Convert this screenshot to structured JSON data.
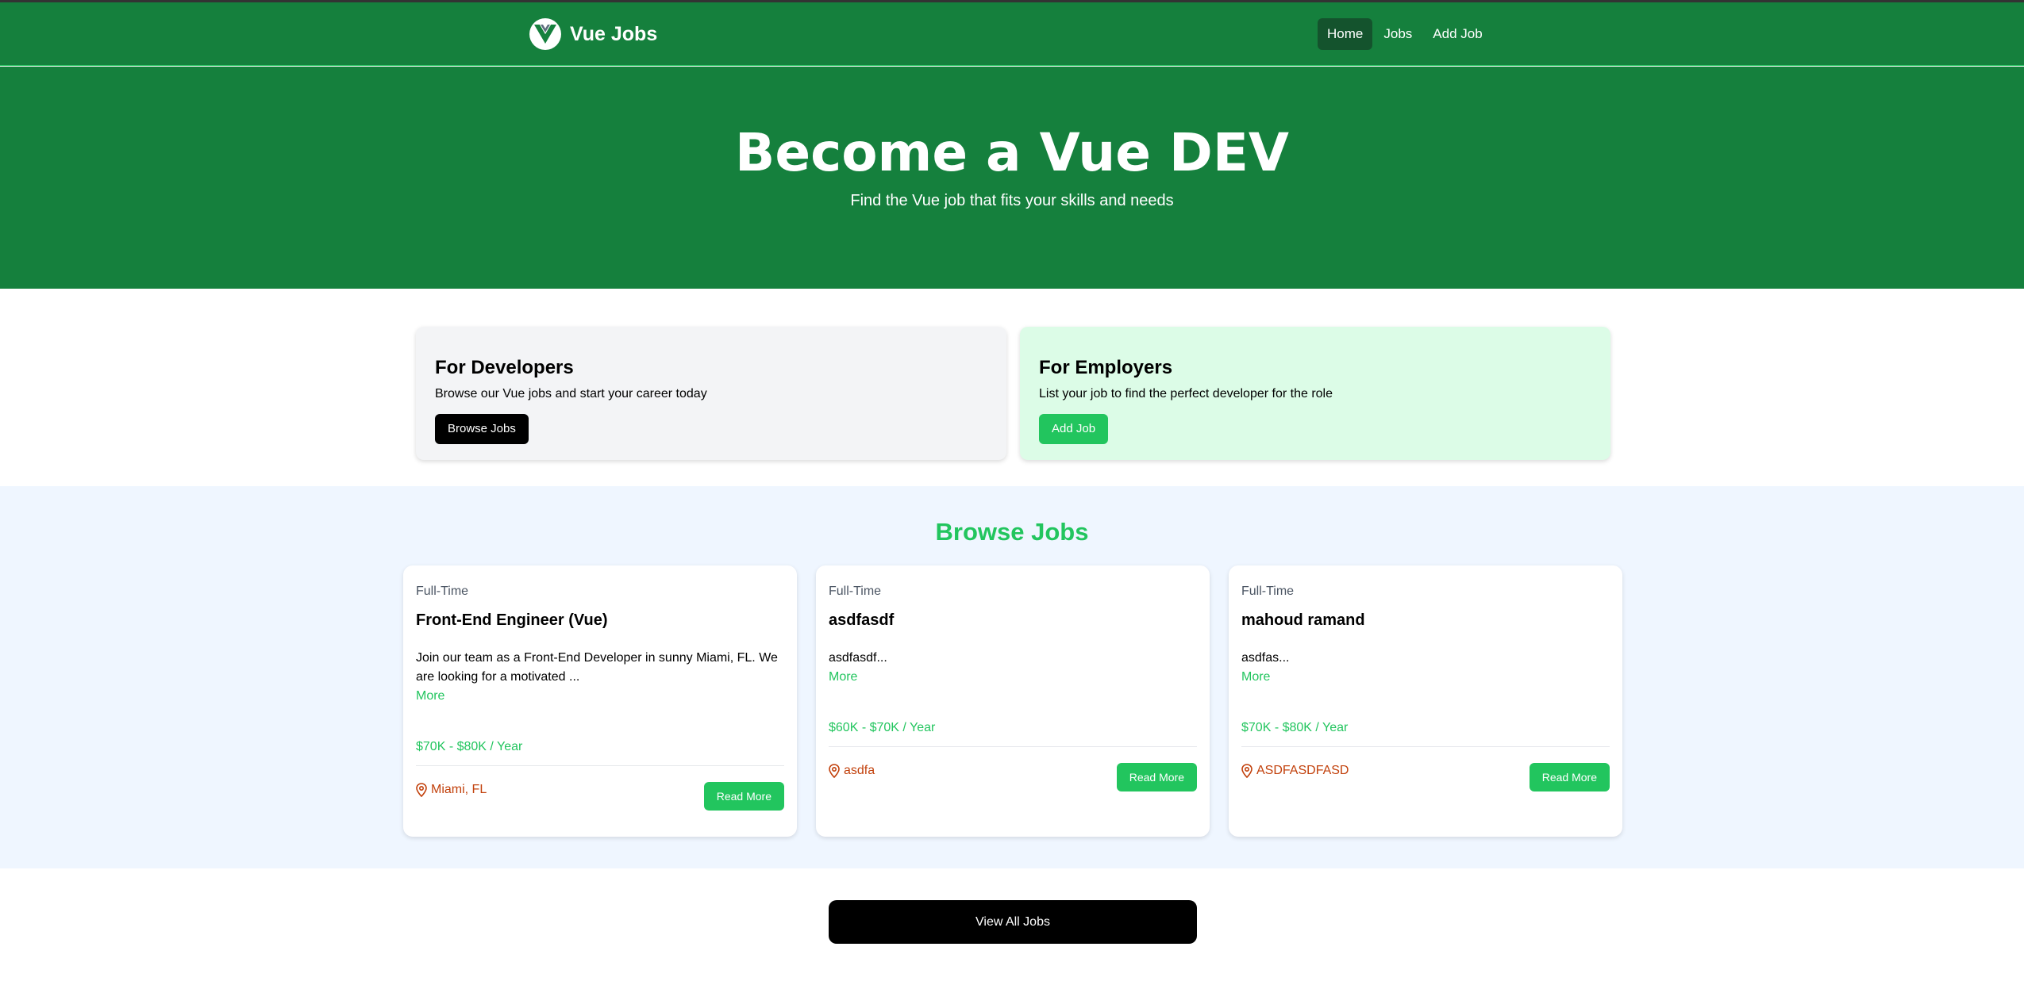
{
  "nav": {
    "brand": "Vue Jobs",
    "links": [
      {
        "label": "Home"
      },
      {
        "label": "Jobs"
      },
      {
        "label": "Add Job"
      }
    ]
  },
  "hero": {
    "title": "Become a Vue DEV",
    "subtitle": "Find the Vue job that fits your skills and needs"
  },
  "developers": {
    "title": "For Developers",
    "text": "Browse our Vue jobs and start your career today",
    "button": "Browse Jobs"
  },
  "employers": {
    "title": "For Employers",
    "text": "List your job to find the perfect developer for the role",
    "button": "Add Job"
  },
  "browse": {
    "title": "Browse Jobs",
    "jobs": [
      {
        "type": "Full-Time",
        "title": "Front-End Engineer (Vue)",
        "description": "Join our team as a Front-End Developer in sunny Miami, FL. We are looking for a motivated ...",
        "more": "More",
        "salary": "$70K - $80K / Year",
        "location": "Miami, FL",
        "button": "Read More"
      },
      {
        "type": "Full-Time",
        "title": "asdfasdf",
        "description": "asdfasdf...",
        "more": "More",
        "salary": "$60K - $70K / Year",
        "location": "asdfa",
        "button": "Read More"
      },
      {
        "type": "Full-Time",
        "title": "mahoud ramand",
        "description": "asdfas...",
        "more": "More",
        "salary": "$70K - $80K / Year",
        "location": "ASDFASDFASD",
        "button": "Read More"
      }
    ]
  },
  "view_all": "View All Jobs",
  "colors": {
    "primary_green": "#15803d",
    "accent_green": "#22c55e",
    "location_orange": "#c2410c"
  }
}
